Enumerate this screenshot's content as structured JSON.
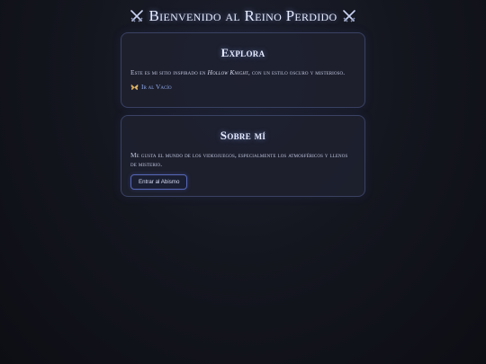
{
  "header": {
    "title": "Bienvenido al Reino Perdido",
    "icon_left": "crossed-swords-icon",
    "icon_right": "crossed-swords-icon"
  },
  "explora": {
    "title": "Explora",
    "text_before": "Este es mi sitio inspirado en ",
    "text_emphasis": "Hollow Knight",
    "text_after": ", con un estilo oscuro y misterioso.",
    "link_icon": "butterfly-icon",
    "link_label": "Ir al Vacío"
  },
  "sobre": {
    "title": "Sobre mí",
    "text": "Me gusta el mundo de los videojuegos, especialmente los atmosféricos y llenos de misterio.",
    "button_label": "Entrar al Abismo"
  },
  "colors": {
    "background": "#14161f",
    "card_border": "#3a4263",
    "accent": "#8fa8e8",
    "title_glow": "#8caaff"
  }
}
